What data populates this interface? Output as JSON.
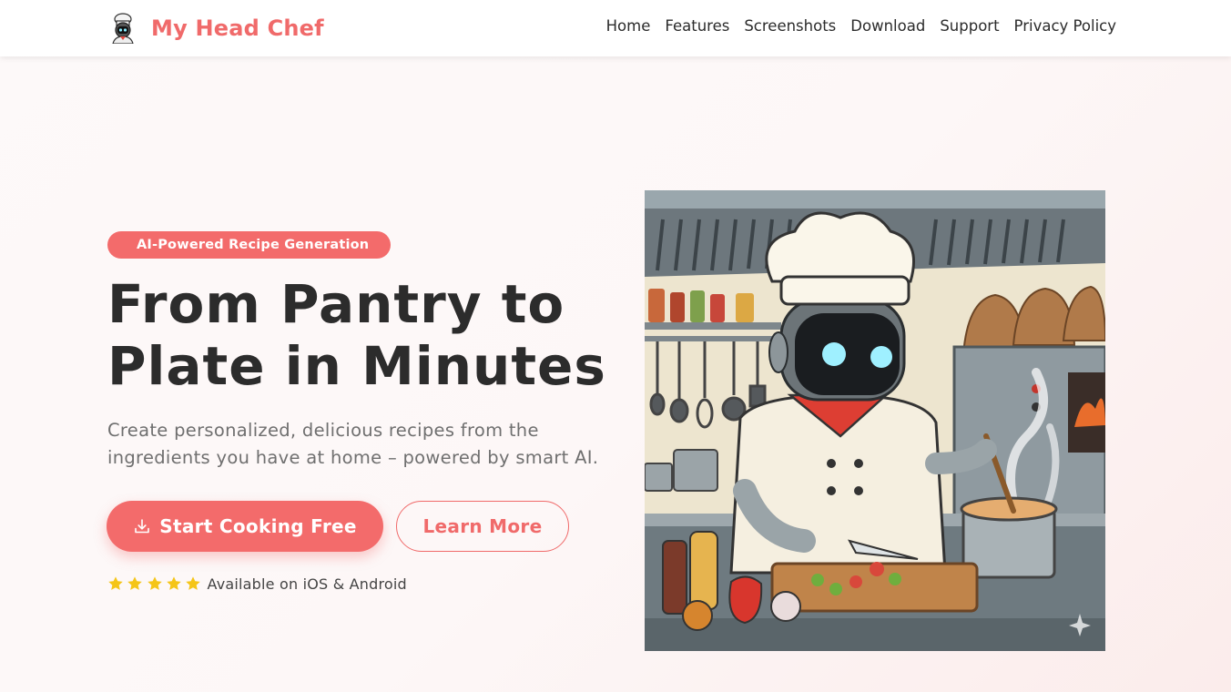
{
  "brand": {
    "name": "My Head Chef",
    "logo_icon": "robot-chef-logo-icon",
    "color": "#f06a6a"
  },
  "nav": {
    "items": [
      {
        "label": "Home"
      },
      {
        "label": "Features"
      },
      {
        "label": "Screenshots"
      },
      {
        "label": "Download"
      },
      {
        "label": "Support"
      },
      {
        "label": "Privacy Policy"
      }
    ]
  },
  "hero": {
    "badge": "AI-Powered Recipe Generation",
    "title_line1": "From Pantry to",
    "title_line2": "Plate in Minutes",
    "subtitle": "Create personalized, delicious recipes from the ingredients you have at home – powered by smart AI.",
    "primary_button": {
      "label": "Start Cooking Free",
      "icon": "download-icon"
    },
    "secondary_button": {
      "label": "Learn More"
    },
    "rating": {
      "stars": 5,
      "star_color": "#f5c518",
      "text": "Available on iOS & Android"
    },
    "image": {
      "icon": "robot-chef-cooking-illustration"
    }
  },
  "colors": {
    "accent": "#f36b6b",
    "heading": "#2c2c2c",
    "muted": "#6f6f6f"
  }
}
